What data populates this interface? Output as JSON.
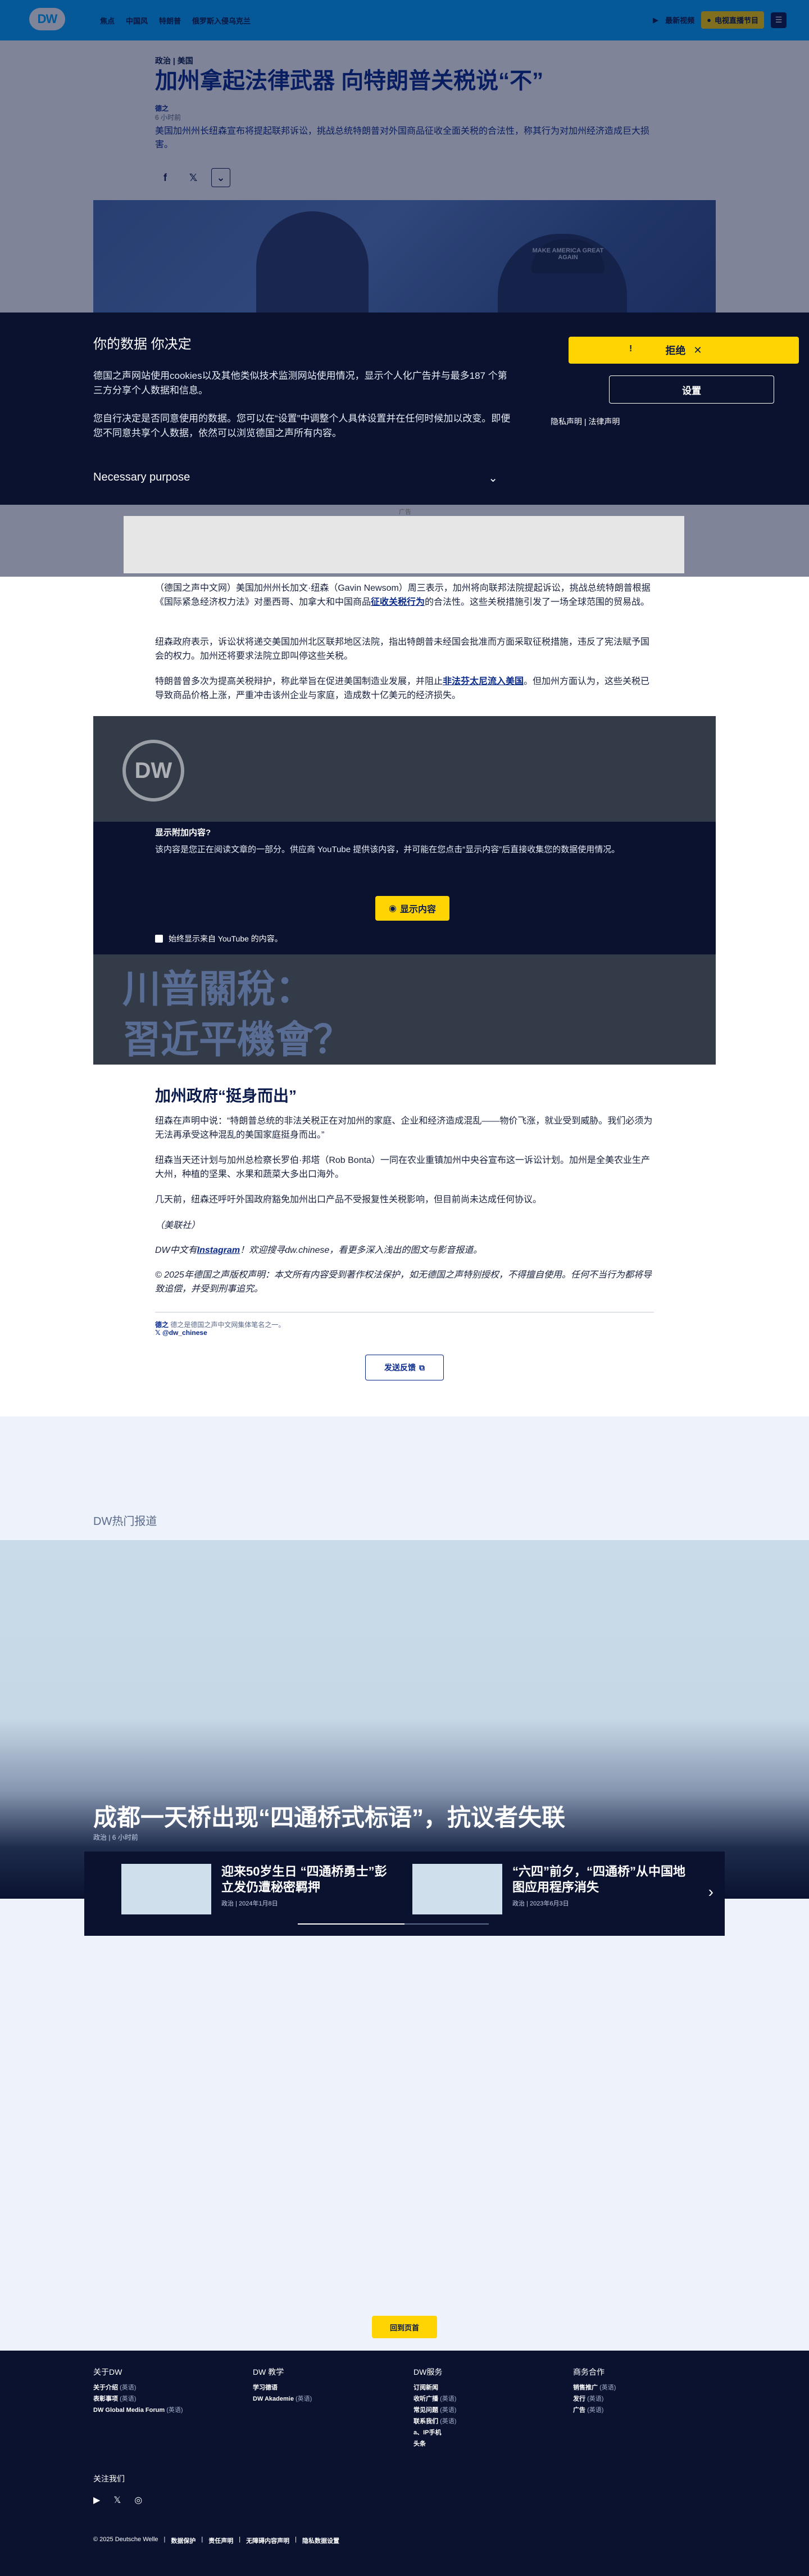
{
  "header": {
    "logo": "DW",
    "nav": [
      "焦点",
      "中国风",
      "特朗普",
      "俄罗斯入侵乌克兰"
    ],
    "video_link": "最新视频",
    "live_button": "电视直播节目",
    "menu_icon": "menu-icon"
  },
  "article": {
    "kicker": "政治 | 美国",
    "title": "加州拿起法律武器 向特朗普关税说“不”",
    "author": "德之",
    "time": "6 小时前",
    "lead": "美国加州州长纽森宣布将提起联邦诉讼，挑战总统特朗普对外国商品征收全面关税的合法性，称其行为对加州经济造成巨大损害。",
    "share": {
      "facebook": "f",
      "x": "𝕏",
      "more": "⌄"
    },
    "hero_cap_text": "MAKE AMERICA GREAT AGAIN"
  },
  "cookie": {
    "title": "你的数据 你决定",
    "p1": "德国之声网站使用cookies以及其他类似技术监测网站使用情况，显示个人化广告并与最多187 个第三方分享个人数据和信息。",
    "p2": "您自行决定是否同意使用的数据。您可以在“设置”中调整个人具体设置并在任何时候加以改变。即便您不同意共享个人数据，依然可以浏览德国之声所有内容。",
    "purpose": "Necessary purpose",
    "reject": "拒绝",
    "reject_info": "!",
    "settings": "设置",
    "privacy": "隐私声明",
    "legal": "法律声明"
  },
  "ad": {
    "label": "广告"
  },
  "body": {
    "p1": "（德国之声中文网）美国加州州长加文·纽森（Gavin Newsom）周三表示，加州将向联邦法院提起诉讼，挑战总统特朗普根据《国际紧急经济权力法》对墨西哥、加拿大和中国商品",
    "p1_link": "征收关税行为",
    "p1_end": "的合法性。这些关税措施引发了一场全球范围的贸易战。",
    "p2": "纽森政府表示，诉讼状将递交美国加州北区联邦地区法院，指出特朗普未经国会批准而方面采取征税措施，违反了宪法赋予国会的权力。加州还将要求法院立即叫停这些关税。",
    "p3": "特朗普曾多次为提高关税辩护，称此举旨在促进美国制造业发展，并阻止",
    "p3_link": "非法芬太尼流入美国",
    "p3_end": "。但加州方面认为，这些关税已导致商品价格上涨，严重冲击该州企业与家庭，造成数十亿美元的经济损失。",
    "video": {
      "logo": "DW",
      "overlay_title": "显示附加内容?",
      "overlay_text": "该内容是您正在阅读文章的一部分。供应商 YouTube 提供该内容，并可能在您点击“显示内容”后直接收集您的数据使用情况。",
      "show_button": "显示内容",
      "always_show": "始终显示来自 YouTube 的内容。",
      "bg_text1": "川普關稅：",
      "bg_text2": "習近平機會？"
    },
    "h2": "加州政府“挺身而出”",
    "p4": "纽森在声明中说：“特朗普总统的非法关税正在对加州的家庭、企业和经济造成混乱——物价飞涨，就业受到威胁。我们必须为无法再承受这种混乱的美国家庭挺身而出。”",
    "p5": "纽森当天还计划与加州总检察长罗伯·邦塔（Rob Bonta）一同在农业重镇加州中央谷宣布这一诉讼计划。加州是全美农业生产大州，种植的坚果、水果和蔬菜大多出口海外。",
    "p6": "几天前，纽森还呼吁外国政府豁免加州出口产品不受报复性关税影响，但目前尚未达成任何协议。",
    "source": "（美联社）",
    "insta_pre": "DW中文有",
    "insta_link": "Instagram",
    "insta_post": "！欢迎搜寻dw.chinese，看更多深入浅出的图文与影音报道。",
    "copyright": "© 2025年德国之声版权声明：本文所有内容受到著作权法保护，如无德国之声特别授权，不得擅自使用。任何不当行为都将导致追偿，并受到刑事追究。",
    "footer_author_name": "德之",
    "footer_author_desc": "德之是德国之声中文网集体笔名之一。",
    "footer_x": "@dw_chinese",
    "feedback": "发送反馈"
  },
  "hot": {
    "label": "DW热门报道",
    "title": "成都一天桥出现“四通桥式标语”，抗议者失联",
    "meta": "政治 | 6 小时前",
    "items": [
      {
        "title": "迎来50岁生日 “四通桥勇士”彭立发仍遭秘密羁押",
        "meta": "政治 | 2024年1月8日"
      },
      {
        "title": "“六四”前夕，“四通桥”从中国地图应用程序消失",
        "meta": "政治 | 2023年6月3日"
      }
    ],
    "back_top": "回到页首"
  },
  "footer": {
    "cols": [
      {
        "title": "关于DW",
        "items": [
          [
            "关于介绍",
            "(英语)"
          ],
          [
            "表彰事项",
            "(英语)"
          ],
          [
            "DW Global Media Forum",
            "(英语)"
          ]
        ]
      },
      {
        "title": "DW 教学",
        "items": [
          [
            "学习德语",
            ""
          ],
          [
            "DW Akademie",
            "(英语)"
          ]
        ]
      },
      {
        "title": "DW服务",
        "items": [
          [
            "订阅新闻",
            ""
          ],
          [
            "收听广播",
            "(英语)"
          ],
          [
            "常见问题",
            "(英语)"
          ],
          [
            "联系我们",
            "(英语)"
          ],
          [
            "a、IP手机",
            ""
          ],
          [
            "头条",
            ""
          ]
        ]
      },
      {
        "title": "商务合作",
        "items": [
          [
            "销售推广",
            "(英语)"
          ],
          [
            "发行",
            "(英语)"
          ],
          [
            "广告",
            "(英语)"
          ]
        ]
      }
    ],
    "follow": "关注我们",
    "social": [
      "▶",
      "𝕏",
      "◎"
    ],
    "legal": [
      "© 2025 Deutsche Welle",
      "数据保护",
      "责任声明",
      "无障碍内容声明",
      "隐私数据设置"
    ]
  }
}
